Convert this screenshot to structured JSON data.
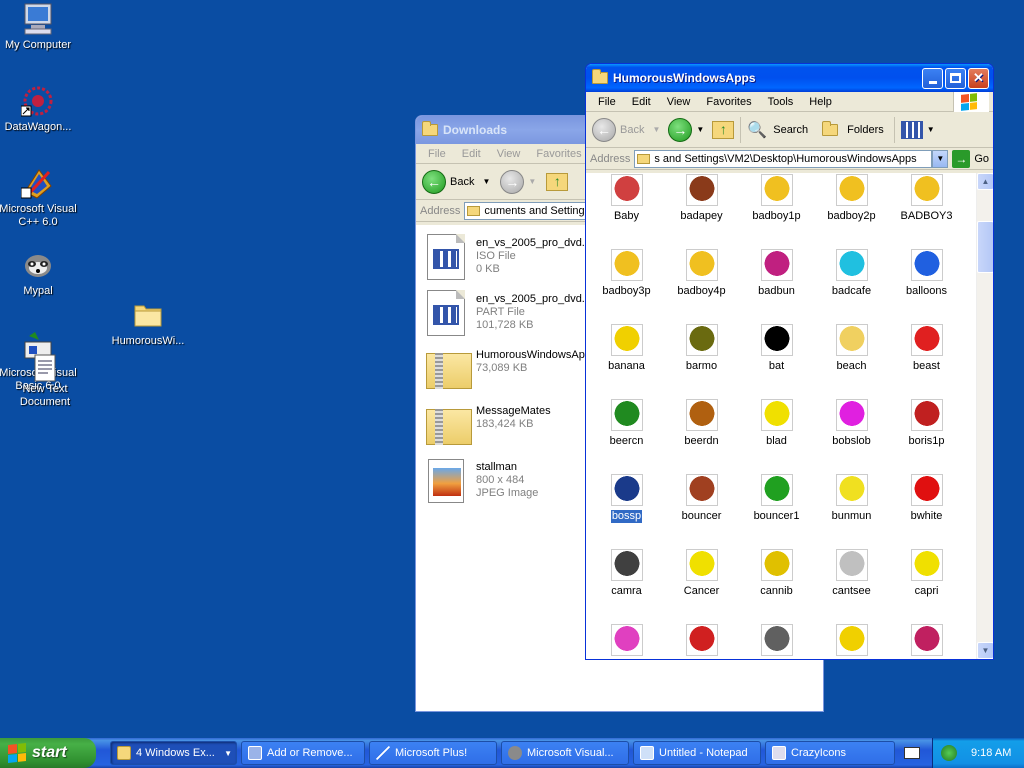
{
  "desktop": {
    "icons": [
      {
        "label": "My Computer",
        "icon": "my-computer-icon"
      },
      {
        "label": "DataWagon...",
        "icon": "datawagon-icon"
      },
      {
        "label": "Microsoft Visual C++ 6.0",
        "icon": "visual-cpp-icon"
      },
      {
        "label": "Mypal",
        "icon": "mypal-raccoon-icon"
      },
      {
        "label": "Microsoft Visual Basic 6.0",
        "icon": "visual-basic-icon"
      },
      {
        "label": "New Text Document",
        "icon": "text-document-icon"
      },
      {
        "label": "HumorousWi...",
        "icon": "folder-icon"
      }
    ]
  },
  "downloads": {
    "title": "Downloads",
    "menu": [
      "File",
      "Edit",
      "View",
      "Favorites"
    ],
    "back_label": "Back",
    "address_label": "Address",
    "address_value": "cuments and Settings",
    "items": [
      {
        "name": "en_vs_2005_pro_dvd...",
        "type": "ISO File",
        "size": "0 KB",
        "icon": "iso-file-icon"
      },
      {
        "name": "en_vs_2005_pro_dvd...",
        "type": "PART File",
        "size": "101,728 KB",
        "icon": "part-file-icon"
      },
      {
        "name": "HumorousWindowsApps",
        "type": "73,089 KB",
        "size": "",
        "icon": "zip-folder-icon"
      },
      {
        "name": "MessageMates",
        "type": "183,424 KB",
        "size": "",
        "icon": "zip-folder-icon"
      },
      {
        "name": "stallman",
        "type": "800 x 484",
        "size": "JPEG Image",
        "icon": "jpeg-image-icon"
      }
    ]
  },
  "humorous": {
    "title": "HumorousWindowsApps",
    "menu": [
      "File",
      "Edit",
      "View",
      "Favorites",
      "Tools",
      "Help"
    ],
    "back_label": "Back",
    "search_label": "Search",
    "folders_label": "Folders",
    "address_label": "Address",
    "address_value": "s and Settings\\VM2\\Desktop\\HumorousWindowsApps",
    "go_label": "Go",
    "selected": "bossp",
    "items": [
      {
        "label": "Baby",
        "color": "#d04040"
      },
      {
        "label": "badapey",
        "color": "#8a3a1a"
      },
      {
        "label": "badboy1p",
        "color": "#f0c020"
      },
      {
        "label": "badboy2p",
        "color": "#f0c020"
      },
      {
        "label": "BADBOY3",
        "color": "#f0c020"
      },
      {
        "label": "badboy3p",
        "color": "#f0c020"
      },
      {
        "label": "badboy4p",
        "color": "#f0c020"
      },
      {
        "label": "badbun",
        "color": "#c02080"
      },
      {
        "label": "badcafe",
        "color": "#20c0e0"
      },
      {
        "label": "balloons",
        "color": "#2060e0"
      },
      {
        "label": "banana",
        "color": "#f0d000"
      },
      {
        "label": "barmo",
        "color": "#6a6a10"
      },
      {
        "label": "bat",
        "color": "#000000"
      },
      {
        "label": "beach",
        "color": "#f0d060"
      },
      {
        "label": "beast",
        "color": "#e02020"
      },
      {
        "label": "beercn",
        "color": "#208a20"
      },
      {
        "label": "beerdn",
        "color": "#b06010"
      },
      {
        "label": "blad",
        "color": "#f0e000"
      },
      {
        "label": "bobslob",
        "color": "#e020e0"
      },
      {
        "label": "boris1p",
        "color": "#c02020"
      },
      {
        "label": "bossp",
        "color": "#1a3a8a"
      },
      {
        "label": "bouncer",
        "color": "#a04020"
      },
      {
        "label": "bouncer1",
        "color": "#20a020"
      },
      {
        "label": "bunmun",
        "color": "#f0e020"
      },
      {
        "label": "bwhite",
        "color": "#e01010"
      },
      {
        "label": "camra",
        "color": "#404040"
      },
      {
        "label": "Cancer",
        "color": "#f0e000"
      },
      {
        "label": "cannib",
        "color": "#e0c000"
      },
      {
        "label": "cantsee",
        "color": "#c0c0c0"
      },
      {
        "label": "capri",
        "color": "#f0e000"
      },
      {
        "label": "",
        "color": "#e040c0"
      },
      {
        "label": "",
        "color": "#d02020"
      },
      {
        "label": "",
        "color": "#606060"
      },
      {
        "label": "",
        "color": "#f0d000"
      },
      {
        "label": "",
        "color": "#c02060"
      }
    ]
  },
  "taskbar": {
    "start_label": "start",
    "buttons": [
      {
        "label": "4 Windows Ex...",
        "icon": "folder-icon",
        "active": true
      },
      {
        "label": "Add or Remove...",
        "icon": "add-remove-icon",
        "active": false
      },
      {
        "label": "Microsoft Plus!",
        "icon": "plus-icon",
        "active": false
      },
      {
        "label": "Microsoft Visual...",
        "icon": "visual-icon",
        "active": false
      },
      {
        "label": "Untitled - Notepad",
        "icon": "notepad-icon",
        "active": false
      },
      {
        "label": "CrazyIcons",
        "icon": "window-icon",
        "active": false
      }
    ],
    "clock": "9:18 AM"
  }
}
